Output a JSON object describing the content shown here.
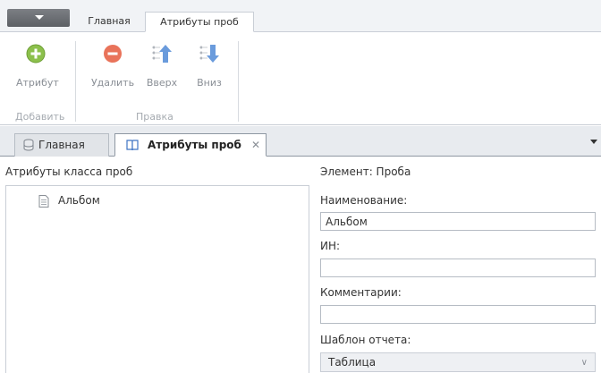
{
  "ribbon": {
    "tabs": [
      "Главная",
      "Атрибуты проб"
    ],
    "active_tab": "Атрибуты проб",
    "buttons": {
      "add": "Атрибут",
      "delete": "Удалить",
      "up": "Вверх",
      "down": "Вниз"
    },
    "groups": {
      "add": "Добавить",
      "edit": "Правка"
    }
  },
  "doc_tabs": {
    "home": "Главная",
    "attributes": "Атрибуты проб",
    "close_glyph": "✕"
  },
  "left_panel": {
    "title": "Атрибуты класса проб",
    "items": [
      "Альбом"
    ]
  },
  "right_panel": {
    "element_label": "Элемент: Проба",
    "name_label": "Наименование:",
    "name_value": "Альбом",
    "in_label": "ИН:",
    "in_value": "",
    "comment_label": "Комментарии:",
    "comment_value": "",
    "report_label": "Шаблон отчета:",
    "report_value": "Таблица"
  },
  "colors": {
    "add_icon": "#8cc04c",
    "delete_icon": "#e9735a",
    "arrow_icon": "#6a9bdc"
  }
}
